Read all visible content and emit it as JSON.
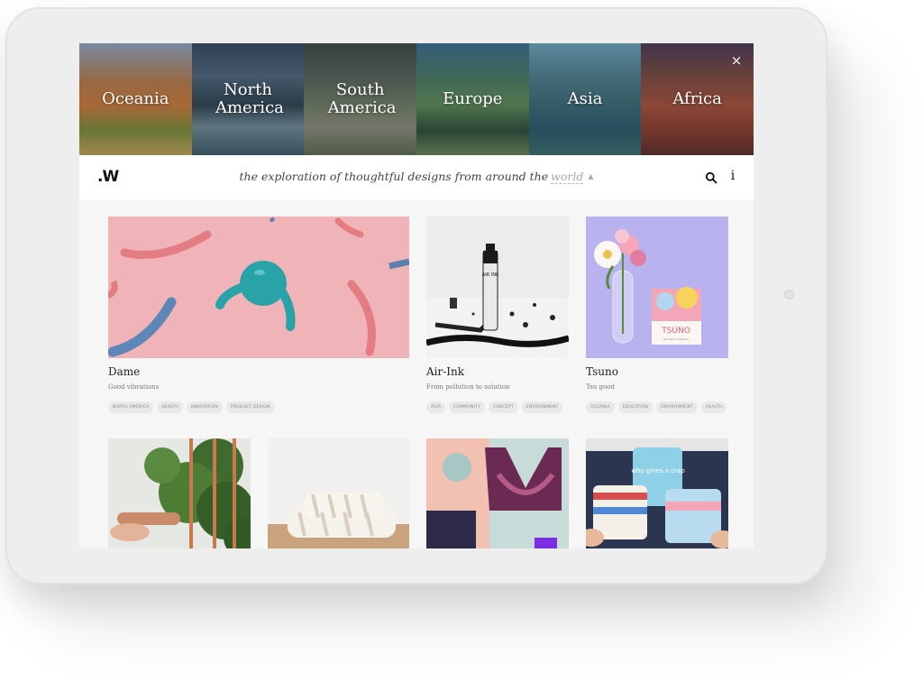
{
  "regions": [
    "Oceania",
    "North America",
    "South America",
    "Europe",
    "Asia",
    "Africa"
  ],
  "close_icon": "×",
  "header": {
    "logo": ".W",
    "tagline": "the exploration of thoughtful designs from around the",
    "tagline_link": "world",
    "info_label": "i"
  },
  "cards": [
    {
      "title": "Dame",
      "subtitle": "Good vibrations",
      "tags": [
        "NORTH AMERICA",
        "HEALTH",
        "INNOVATION",
        "PRODUCT DESIGN"
      ]
    },
    {
      "title": "Air-Ink",
      "subtitle": "From pollution to solution",
      "tags": [
        "ASIA",
        "COMMUNITY",
        "CONCEPT",
        "ENVIRONMENT"
      ]
    },
    {
      "title": "Tsuno",
      "subtitle": "Tsu good",
      "tags": [
        "OCEANIA",
        "EDUCATION",
        "ENVIRONMENT",
        "HEALTH"
      ]
    }
  ],
  "image_text": {
    "airink_bottle": "AIR INK",
    "tsuno_box": "TSUNO",
    "tsuno_box_small": "NATURAL BAMBOO",
    "toilet_roll": "who gives a crap"
  },
  "colors": {
    "accent_muted": "#a8a8a8",
    "screen_bg": "#f6f6f7",
    "tag_bg": "#e9e9ea"
  }
}
